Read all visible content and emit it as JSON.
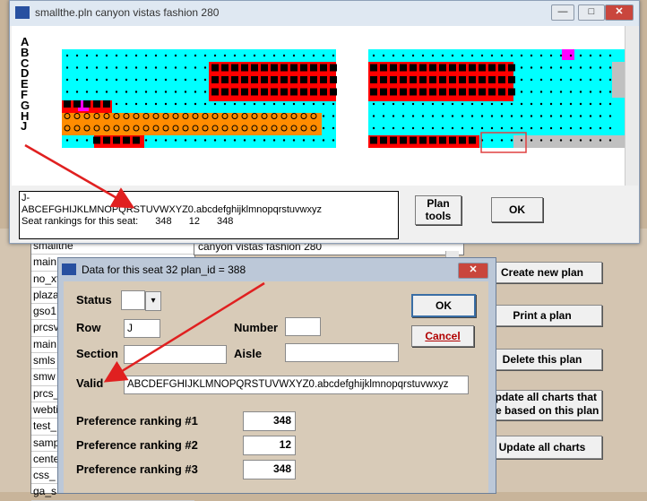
{
  "back": {
    "list_items": [
      "smallthe",
      "main",
      "no_xt",
      "plaza",
      "gso1",
      "prcsv",
      "main",
      "smls",
      "smw",
      "prcs_",
      "webti",
      "test_",
      "samp",
      "cente",
      "css_",
      "ga_s"
    ],
    "selected_desc": "canyon vistas fashion 280",
    "buttons": [
      "Create new plan",
      "Print a plan",
      "Delete this plan",
      "Update all charts that are based on this plan",
      "Update all charts"
    ]
  },
  "topwin": {
    "title": "smallthe.pln canyon vistas fashion 280",
    "controls": {
      "minimize": "—",
      "maximize": "□",
      "close": "✕"
    },
    "row_letters": [
      "A",
      "B",
      "C",
      "D",
      "E",
      "F",
      "G",
      "H",
      "J"
    ],
    "info_line1": "J-",
    "info_line2": "ABCEFGHIJKLMNOPQRSTUVWXYZ0.abcdefghijklmnopqrstuvwxyz",
    "info_line3_label": "Seat rankings for this seat:",
    "info_values": [
      "348",
      "12",
      "348"
    ],
    "plan_tools": "Plan tools",
    "ok": "OK"
  },
  "dialog": {
    "title": "Data for this seat  32 plan_id = 388",
    "status_label": "Status",
    "row_label": "Row",
    "row_value": "J",
    "number_label": "Number",
    "section_label": "Section",
    "aisle_label": "Aisle",
    "valid_label": "Valid",
    "valid_value": "ABCDEFGHIJKLMNOPQRSTUVWXYZ0.abcdefghijklmnopqrstuvwxyz",
    "pref1_label": "Preference ranking #1",
    "pref1": "348",
    "pref2_label": "Preference ranking #2",
    "pref2": "12",
    "pref3_label": "Preference ranking #3",
    "pref3": "348",
    "ok": "OK",
    "cancel": "Cancel"
  },
  "colors": {
    "cyan": "#00ffff",
    "red": "#ff0000",
    "orange": "#ff8c00",
    "magenta": "#ff00ff",
    "gray": "#c0c0c0",
    "arrow": "#e02020"
  }
}
